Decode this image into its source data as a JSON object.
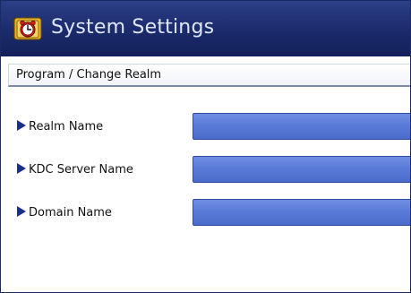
{
  "app": {
    "title": "System Settings"
  },
  "page": {
    "title": "Program / Change Realm"
  },
  "fields": [
    {
      "label": "Realm Name"
    },
    {
      "label": "KDC Server Name"
    },
    {
      "label": "Domain Name"
    }
  ],
  "icons": {
    "app_icon": "alarm-clock-icon",
    "bullet": "triangle-right-icon"
  },
  "colors": {
    "header_bg": "#1b2a6a",
    "header_text": "#dfe6ff",
    "field_bg": "#5b7bd8",
    "bullet": "#1b2f8a"
  }
}
